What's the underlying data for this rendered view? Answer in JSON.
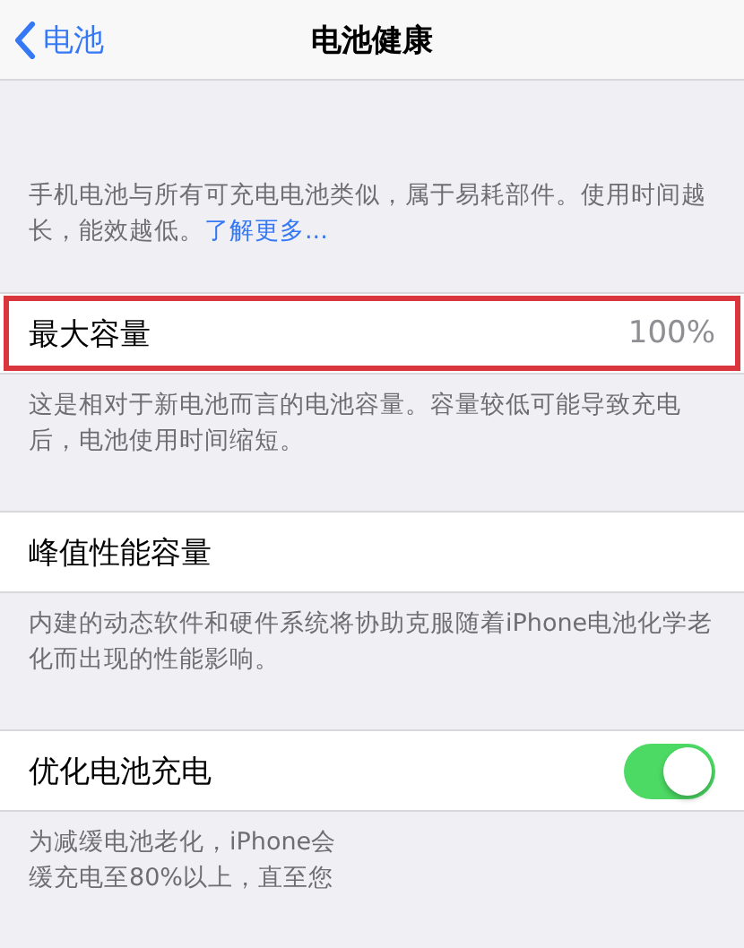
{
  "nav": {
    "back": "电池",
    "title": "电池健康"
  },
  "intro": {
    "text": "手机电池与所有可充电电池类似，属于易耗部件。使用时间越长，能效越低。",
    "link": "了解更多..."
  },
  "sections": [
    {
      "kind": "value",
      "label": "最大容量",
      "value": "100%",
      "highlighted": true,
      "footer": [
        "这是相对于新电池而言的电池容量。容量较低可能导致充电后，电池使用时间缩短。"
      ]
    },
    {
      "kind": "plain",
      "label": "峰值性能容量",
      "highlighted": false,
      "footer": [
        "内建的动态软件和硬件系统将协助克服随着iPhone电池化学老化而出现的性能影响。"
      ]
    },
    {
      "kind": "toggle",
      "label": "优化电池充电",
      "on": true,
      "highlighted": false,
      "footer": [
        "为减缓电池老化，iPhone会",
        "缓充电至80%以上，直至您"
      ]
    }
  ]
}
